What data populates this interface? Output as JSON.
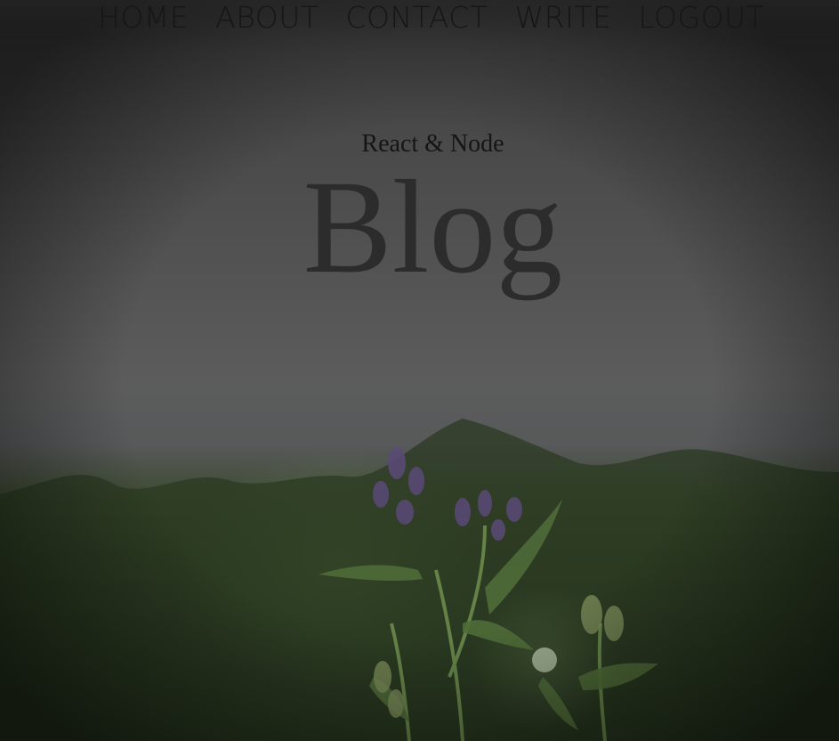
{
  "nav": {
    "items": [
      {
        "label": "HOME"
      },
      {
        "label": "ABOUT"
      },
      {
        "label": "CONTACT"
      },
      {
        "label": "WRITE"
      },
      {
        "label": "LOGOUT"
      }
    ]
  },
  "header": {
    "subtitle": "React & Node",
    "title": "Blog"
  },
  "colors": {
    "nav_text": "#161616",
    "title_text": "#2c2c2c",
    "overlay": "#3a3a3a"
  }
}
